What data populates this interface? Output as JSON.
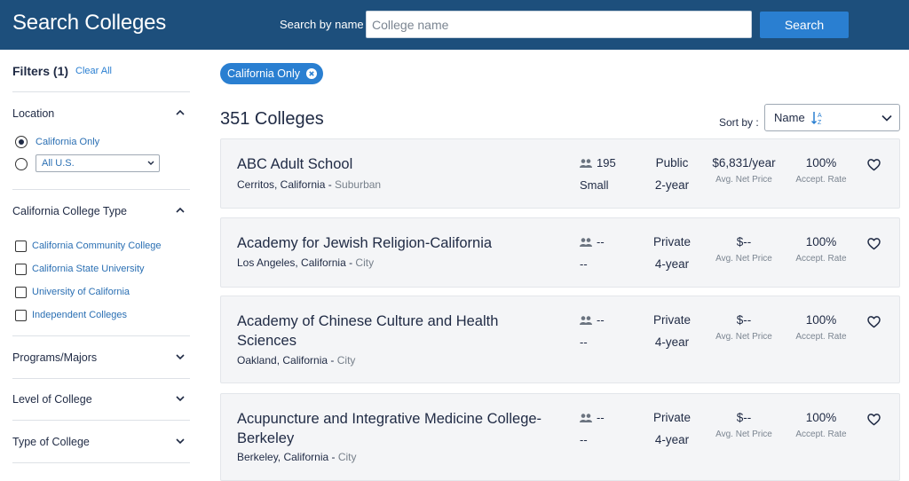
{
  "header": {
    "title": "Search Colleges",
    "search_label": "Search by name",
    "search_placeholder": "College name",
    "search_value": "",
    "search_button": "Search"
  },
  "sidebar": {
    "filters_title": "Filters (1)",
    "clear_all": "Clear All",
    "location": {
      "title": "Location",
      "option_california": "California Only",
      "region_select_value": "All U.S."
    },
    "college_type": {
      "title": "California College Type",
      "options": [
        "California Community College",
        "California State University",
        "University of California",
        "Independent Colleges"
      ]
    },
    "collapsed_sections": [
      "Programs/Majors",
      "Level of College",
      "Type of College"
    ]
  },
  "main": {
    "active_chip": "California Only",
    "results_count": "351 Colleges",
    "sort_label": "Sort by :",
    "sort_value": "Name"
  },
  "colleges": [
    {
      "name": "ABC Adult School",
      "city": "Cerritos, California",
      "setting": "Suburban",
      "enrollment": "195",
      "size": "Small",
      "control": "Public",
      "length": "2-year",
      "net_price": "$6,831/year",
      "net_price_label": "Avg. Net Price",
      "acceptance": "100%",
      "acceptance_label": "Accept. Rate"
    },
    {
      "name": "Academy for Jewish Religion-California",
      "city": "Los Angeles, California",
      "setting": "City",
      "enrollment": "--",
      "size": "--",
      "control": "Private",
      "length": "4-year",
      "net_price": "$--",
      "net_price_label": "Avg. Net Price",
      "acceptance": "100%",
      "acceptance_label": "Accept. Rate"
    },
    {
      "name": "Academy of Chinese Culture and Health Sciences",
      "city": "Oakland, California",
      "setting": "City",
      "enrollment": "--",
      "size": "--",
      "control": "Private",
      "length": "4-year",
      "net_price": "$--",
      "net_price_label": "Avg. Net Price",
      "acceptance": "100%",
      "acceptance_label": "Accept. Rate"
    },
    {
      "name": "Acupuncture and Integrative Medicine College-Berkeley",
      "city": "Berkeley, California",
      "setting": "City",
      "enrollment": "--",
      "size": "--",
      "control": "Private",
      "length": "4-year",
      "net_price": "$--",
      "net_price_label": "Avg. Net Price",
      "acceptance": "100%",
      "acceptance_label": "Accept. Rate"
    }
  ],
  "colors": {
    "header_bg": "#1d4f7c",
    "accent": "#2a7fd1",
    "link": "#2a6fb3",
    "card_bg": "#f4f5f7"
  }
}
